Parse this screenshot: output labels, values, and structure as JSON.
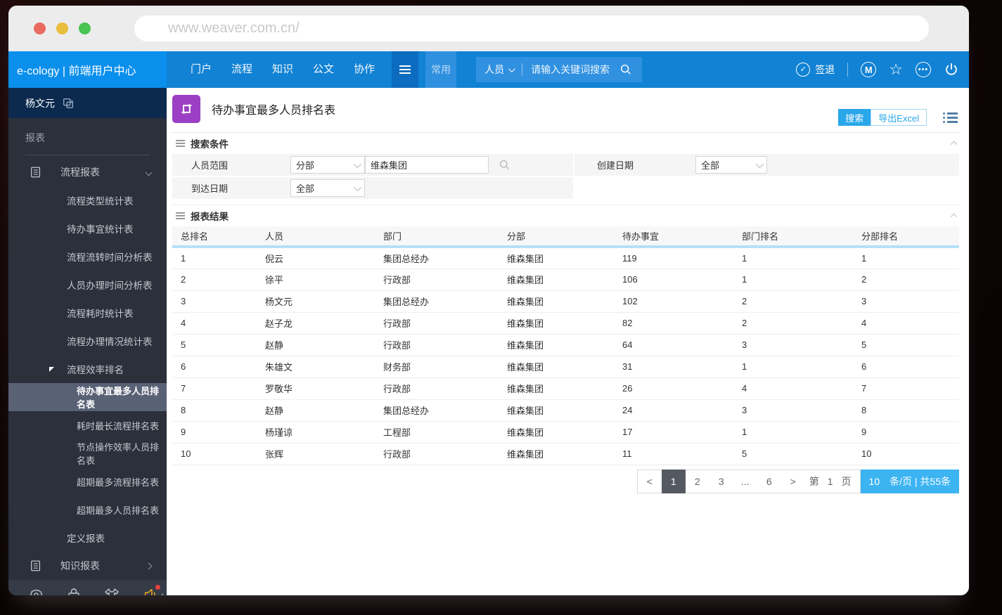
{
  "browser": {
    "url": "www.weaver.com.cn/"
  },
  "topnav": {
    "brand": "e-cology | 前端用户中心",
    "items": [
      "门户",
      "流程",
      "知识",
      "公文",
      "协作"
    ],
    "quick_label": "常用",
    "search": {
      "scope": "人员",
      "placeholder": "请输入关键词搜索"
    },
    "signout_label": "签退",
    "m_badge": "M"
  },
  "sidebar": {
    "user": "杨文元",
    "section_label": "报表",
    "items": [
      {
        "label": "流程报表"
      },
      {
        "label": "流程类型统计表"
      },
      {
        "label": "待办事宜统计表"
      },
      {
        "label": "流程流转时间分析表"
      },
      {
        "label": "人员办理时间分析表"
      },
      {
        "label": "流程耗时统计表"
      },
      {
        "label": "流程办理情况统计表"
      },
      {
        "label": "流程效率排名"
      },
      {
        "label": "待办事宜最多人员排名表"
      },
      {
        "label": "耗时最长流程排名表"
      },
      {
        "label": "节点操作效率人员排名表"
      },
      {
        "label": "超期最多流程排名表"
      },
      {
        "label": "超期最多人员排名表"
      },
      {
        "label": "定义报表"
      },
      {
        "label": "知识报表"
      }
    ]
  },
  "main": {
    "title": "待办事宜最多人员排名表",
    "search_button": "搜索",
    "export_button": "导出Excel",
    "search_section": {
      "title": "搜索条件",
      "scope_label": "人员范围",
      "scope_type": "分部",
      "scope_value": "维森集团",
      "create_date_label": "创建日期",
      "create_date_value": "全部",
      "arrive_date_label": "到达日期",
      "arrive_date_value": "全部"
    },
    "results": {
      "title": "报表结果",
      "headers": [
        "总排名",
        "人员",
        "部门",
        "分部",
        "待办事宜",
        "部门排名",
        "分部排名"
      ],
      "rows": [
        {
          "rank": "1",
          "person": "倪云",
          "dept": "集团总经办",
          "branch": "维森集团",
          "todo": "119",
          "dept_rank": "1",
          "branch_rank": "1"
        },
        {
          "rank": "2",
          "person": "徐平",
          "dept": "行政部",
          "branch": "维森集团",
          "todo": "106",
          "dept_rank": "1",
          "branch_rank": "2"
        },
        {
          "rank": "3",
          "person": "杨文元",
          "dept": "集团总经办",
          "branch": "维森集团",
          "todo": "102",
          "dept_rank": "2",
          "branch_rank": "3"
        },
        {
          "rank": "4",
          "person": "赵子龙",
          "dept": "行政部",
          "branch": "维森集团",
          "todo": "82",
          "dept_rank": "2",
          "branch_rank": "4"
        },
        {
          "rank": "5",
          "person": "赵静",
          "dept": "行政部",
          "branch": "维森集团",
          "todo": "64",
          "dept_rank": "3",
          "branch_rank": "5"
        },
        {
          "rank": "6",
          "person": "朱雄文",
          "dept": "财务部",
          "branch": "维森集团",
          "todo": "31",
          "dept_rank": "1",
          "branch_rank": "6"
        },
        {
          "rank": "7",
          "person": "罗敬华",
          "dept": "行政部",
          "branch": "维森集团",
          "todo": "26",
          "dept_rank": "4",
          "branch_rank": "7"
        },
        {
          "rank": "8",
          "person": "赵静",
          "dept": "集团总经办",
          "branch": "维森集团",
          "todo": "24",
          "dept_rank": "3",
          "branch_rank": "8"
        },
        {
          "rank": "9",
          "person": "杨瑾谅",
          "dept": "工程部",
          "branch": "维森集团",
          "todo": "17",
          "dept_rank": "1",
          "branch_rank": "9"
        },
        {
          "rank": "10",
          "person": "张辉",
          "dept": "行政部",
          "branch": "维森集团",
          "todo": "11",
          "dept_rank": "5",
          "branch_rank": "10"
        }
      ]
    },
    "pagination": {
      "prev": "<",
      "pages": [
        "1",
        "2",
        "3",
        "...",
        "6"
      ],
      "next": ">",
      "jump_prefix": "第",
      "jump_value": "1",
      "jump_suffix": "页",
      "page_size": "10",
      "size_info": "条/页 | 共55条"
    }
  }
}
